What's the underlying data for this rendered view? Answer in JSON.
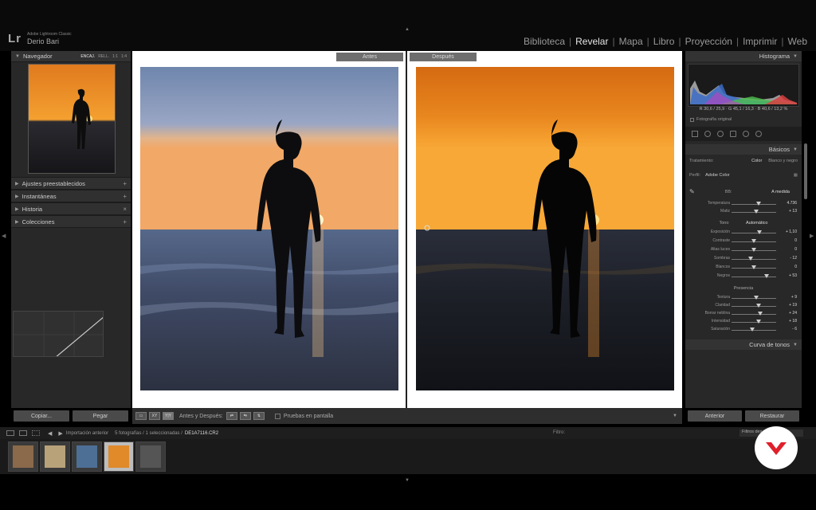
{
  "app": {
    "logo": "Lr",
    "name": "Adobe Lightroom Classic",
    "user": "Derio Bari"
  },
  "modules": [
    {
      "label": "Biblioteca",
      "active": false
    },
    {
      "label": "Revelar",
      "active": true
    },
    {
      "label": "Mapa",
      "active": false
    },
    {
      "label": "Libro",
      "active": false
    },
    {
      "label": "Proyección",
      "active": false
    },
    {
      "label": "Imprimir",
      "active": false
    },
    {
      "label": "Web",
      "active": false
    }
  ],
  "left_panel": {
    "navigator": {
      "title": "Navegador",
      "zoom_options": [
        "ENCAJ.",
        "RELL.",
        "1:1",
        "1:4"
      ]
    },
    "sections": [
      {
        "label": "Ajustes preestablecidos",
        "action": "+"
      },
      {
        "label": "Instantáneas",
        "action": "+"
      },
      {
        "label": "Historia",
        "action": "×"
      },
      {
        "label": "Colecciones",
        "action": "+"
      }
    ],
    "copy_label": "Copiar...",
    "paste_label": "Pegar"
  },
  "center": {
    "before_label": "Antes",
    "after_label": "Después"
  },
  "toolbar": {
    "view_icons": [
      "▭",
      "XY",
      "Y|Y"
    ],
    "before_after_label": "Antes y Después:",
    "soft_proof_label": "Pruebas en pantalla"
  },
  "right_panel": {
    "histogram_title": "Histograma",
    "histogram_values": "R 30,6 / 25,9 · G 45,1 / 16,3 · B 40,6 / 13,2 %",
    "original_photo_label": "Fotografía original",
    "basic_title": "Básicos",
    "treatment_label": "Tratamiento:",
    "treatment_color": "Color",
    "treatment_bw": "Blanco y negro",
    "profile_label": "Perfil:",
    "profile_value": "Adobe Color",
    "wb_label": "BB:",
    "wb_value": "A medida",
    "sliders_wb": [
      {
        "label": "Temperatura",
        "value": "4.736",
        "pos": 0.6
      },
      {
        "label": "Matiz",
        "value": "+ 13",
        "pos": 0.55
      }
    ],
    "tone_label": "Tono",
    "tone_auto": "Automático",
    "sliders_tone": [
      {
        "label": "Exposición",
        "value": "+ 1,10",
        "pos": 0.62
      },
      {
        "label": "Contraste",
        "value": "0",
        "pos": 0.5
      },
      {
        "label": "Altas luces",
        "value": "0",
        "pos": 0.5
      },
      {
        "label": "Sombras",
        "value": "- 12",
        "pos": 0.42
      },
      {
        "label": "Blancos",
        "value": "0",
        "pos": 0.5
      },
      {
        "label": "Negros",
        "value": "+ 53",
        "pos": 0.78
      }
    ],
    "presence_label": "Presencia",
    "sliders_presence": [
      {
        "label": "Textura",
        "value": "+ 9",
        "pos": 0.55
      },
      {
        "label": "Claridad",
        "value": "+ 19",
        "pos": 0.6
      },
      {
        "label": "Borrar neblina",
        "value": "+ 24",
        "pos": 0.64
      },
      {
        "label": "Intensidad",
        "value": "+ 18",
        "pos": 0.6
      },
      {
        "label": "Saturación",
        "value": "- 6",
        "pos": 0.46
      }
    ],
    "curve_title": "Curva de tonos",
    "prev_label": "Anterior",
    "reset_label": "Restaurar"
  },
  "filmbar": {
    "source": "Importación anterior",
    "count": "5 fotografías / 1 seleccionadas /",
    "file": "DE1A7116.CR2",
    "filter_label": "Filtro:",
    "filter_value": "Filtros des."
  },
  "filmstrip": {
    "thumbnails": [
      {
        "name": "photo-1",
        "selected": false,
        "color": "#8a6a4a"
      },
      {
        "name": "photo-2",
        "selected": false,
        "color": "#b8a27a"
      },
      {
        "name": "photo-3",
        "selected": false,
        "color": "#4d6f96"
      },
      {
        "name": "photo-4",
        "selected": true,
        "color": "#e08a2a"
      },
      {
        "name": "photo-5",
        "selected": false,
        "color": "#555555"
      }
    ]
  }
}
